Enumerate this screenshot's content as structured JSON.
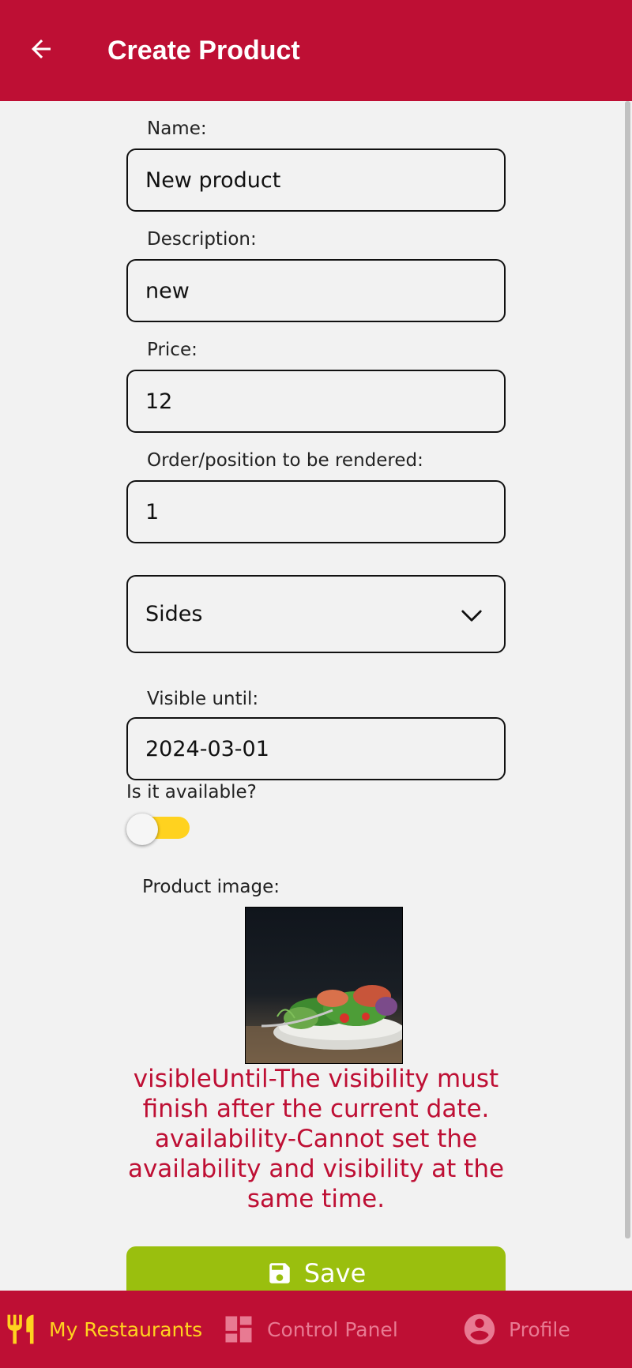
{
  "header": {
    "title": "Create Product"
  },
  "form": {
    "name": {
      "label": "Name:",
      "value": "New product"
    },
    "description": {
      "label": "Description:",
      "value": "new"
    },
    "price": {
      "label": "Price:",
      "value": "12"
    },
    "order": {
      "label": "Order/position to be rendered:",
      "value": "1"
    },
    "category": {
      "selected": "Sides"
    },
    "visible_until": {
      "label": "Visible until:",
      "value": "2024-03-01"
    },
    "availability": {
      "label": "Is it available?",
      "on": true
    },
    "image": {
      "label": "Product image:"
    },
    "error_message": "visibleUntil-The visibility must finish after the current date. availability-Cannot set the availability and visibility at the same time.",
    "save_label": "Save"
  },
  "nav": {
    "items": [
      {
        "label": "My Restaurants",
        "icon": "fork-knife-icon",
        "active": true
      },
      {
        "label": "Control Panel",
        "icon": "dashboard-icon",
        "active": false
      },
      {
        "label": "Profile",
        "icon": "account-circle-icon",
        "active": false
      }
    ]
  },
  "colors": {
    "brand_red": "#be0f34",
    "accent_yellow": "#ffd21f",
    "save_green": "#9abf0e"
  }
}
